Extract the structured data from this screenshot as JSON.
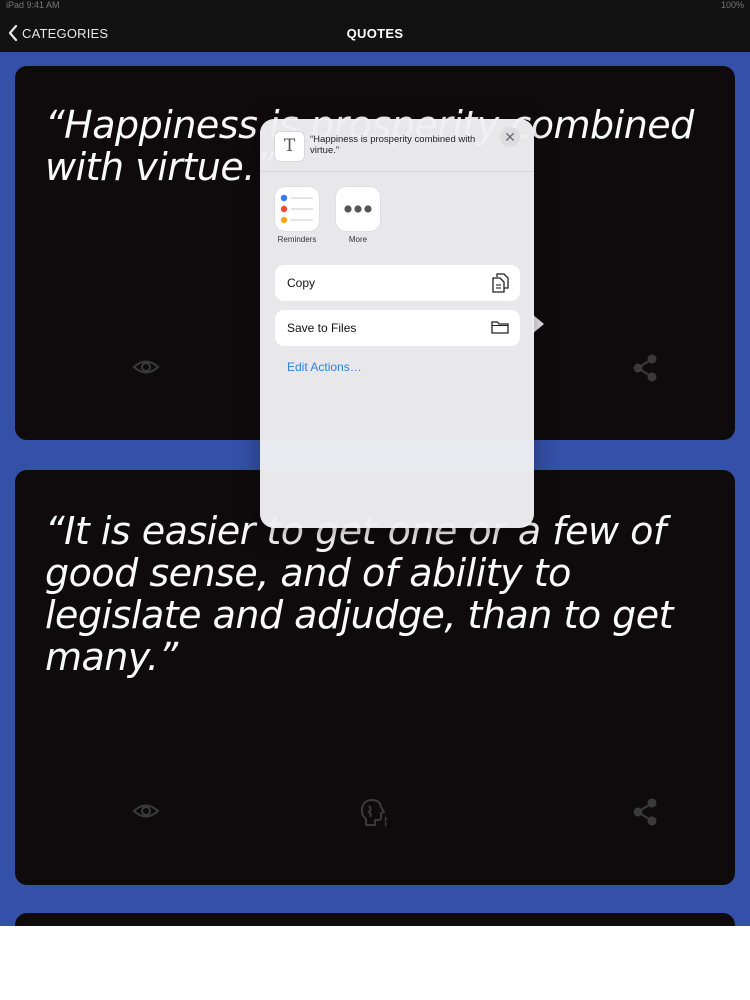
{
  "status_bar": {
    "left": "iPad  9:41 AM",
    "right": "100%"
  },
  "nav": {
    "back_label": "CATEGORIES",
    "title": "QUOTES"
  },
  "cards": [
    {
      "quote": "“Happiness is prosperity combined with virtue.”"
    },
    {
      "quote": "“It is easier to get one or a few of good sense, and of ability to legislate and adjudge, than to get many.”"
    }
  ],
  "share_sheet": {
    "preview_text": "“Happiness is prosperity combined with virtue.”",
    "apps": [
      {
        "label": "Reminders",
        "icon": "reminders-icon"
      },
      {
        "label": "More",
        "icon": "more-icon"
      }
    ],
    "actions": [
      {
        "label": "Copy",
        "icon": "copy-icon"
      },
      {
        "label": "Save to Files",
        "icon": "folder-icon"
      }
    ],
    "edit_actions_label": "Edit Actions…",
    "accent_color": "#2f7ee0"
  },
  "colors": {
    "background": "#3550a8",
    "card": "#0f0b0c",
    "navbar": "#121212"
  }
}
